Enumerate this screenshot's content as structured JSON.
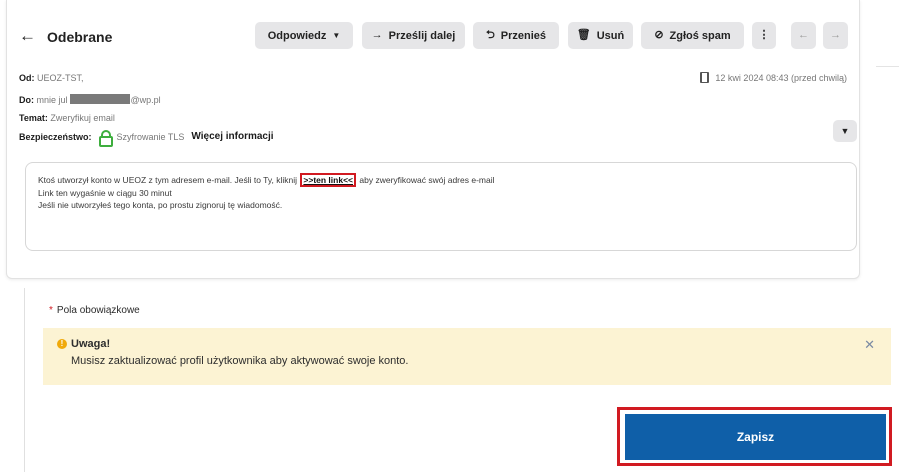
{
  "header": {
    "back_icon": "←",
    "folder_title": "Odebrane"
  },
  "toolbar": {
    "reply_label": "Odpowiedz",
    "reply_dropdown_icon": "▼",
    "forward_icon": "→",
    "forward_label": "Prześlij dalej",
    "move_icon": "⮌",
    "move_label": "Przenieś",
    "delete_icon": "🗑",
    "delete_label": "Usuń",
    "spam_icon": "⊘",
    "spam_label": "Zgłoś spam",
    "more_icon": "⋮",
    "prev_icon": "←",
    "next_icon": "→"
  },
  "message": {
    "from_label": "Od:",
    "from_value": "UEOZ-TST,",
    "to_label": "Do:",
    "to_value_prefix": "mnie jul",
    "to_value_suffix": "@wp.pl",
    "subject_label": "Temat:",
    "subject_value": "Zweryfikuj email",
    "security_label": "Bezpieczeństwo:",
    "security_value": "Szyfrowanie TLS",
    "more_info_label": "Więcej informacji",
    "date": "12 kwi 2024 08:43 (przed chwilą)",
    "expand_icon": "▼",
    "body_line1_before": "Ktoś utworzył konto w UEOZ z tym adresem e-mail. Jeśli to Ty, kliknij",
    "body_link": ">>ten link<<",
    "body_line1_after": "aby zweryfikować swój adres e-mail",
    "body_line2": "Link ten wygaśnie w ciągu 30 minut",
    "body_line3": "Jeśli nie utworzyłeś tego konta, po prostu zignoruj tę wiadomość."
  },
  "form": {
    "required_star": "*",
    "required_note": "Pola obowiązkowe",
    "alert": {
      "icon": "!",
      "title": "Uwaga!",
      "message": "Musisz zaktualizować profil użytkownika aby aktywować swoje konto.",
      "close_icon": "✕"
    },
    "save_label": "Zapisz"
  },
  "colors": {
    "primary": "#0f5fa8",
    "highlight": "#d11a21",
    "alert_bg": "#fcf3d3",
    "warning": "#f0a90b",
    "secure": "#3eae3e"
  }
}
